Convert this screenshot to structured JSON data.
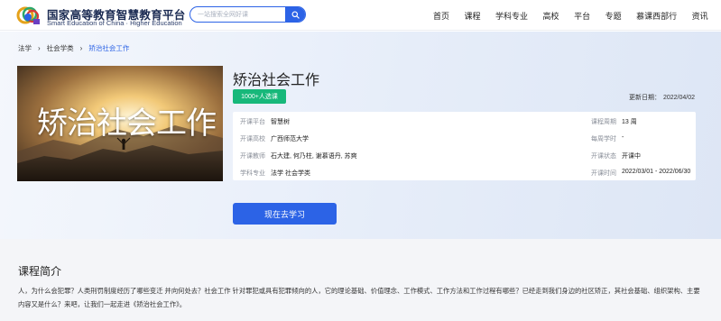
{
  "header": {
    "logo_title": "国家高等教育智慧教育平台",
    "logo_subtitle": "Smart Education of China · Higher Education",
    "search_placeholder": "一站搜索全网好课",
    "nav": [
      "首页",
      "课程",
      "学科专业",
      "高校",
      "平台",
      "专题",
      "慕课西部行",
      "资讯"
    ]
  },
  "breadcrumb": [
    "法学",
    "社会学类",
    "矫治社会工作"
  ],
  "course": {
    "cover_text": "矫治社会工作",
    "title": "矫治社会工作",
    "badge": "1000+人选课",
    "update_label": "更新日期：",
    "update_date": "2022/04/02",
    "info": [
      {
        "k1": "开课平台",
        "v1": "智慧树",
        "k2": "课程周期",
        "v2": "13 周"
      },
      {
        "k1": "开课高校",
        "v1": "广西师范大学",
        "k2": "每周学时",
        "v2": "-"
      },
      {
        "k1": "开课教师",
        "v1": "石大建, 何乃柱, 谢慕语丹, 苏爽",
        "k2": "开课状态",
        "v2": "开课中"
      },
      {
        "k1": "学科专业",
        "v1": "法学  社会学类",
        "k2": "开课时间",
        "v2": "2022/03/01 - 2022/06/30"
      }
    ],
    "study_button": "现在去学习"
  },
  "intro": {
    "title": "课程简介",
    "text": "人，为什么会犯罪？人类刑罚制度经历了哪些变迁 并向何处去？社会工作 针对罪犯或具有犯罪倾向的人，它的理论基础、价值理念、工作模式、工作方法和工作过程有哪些？已经走到我们身边的社区矫正，其社会基础、组织架构、主要内容又是什么？来吧，让我们一起走进《矫治社会工作》。"
  },
  "colors": {
    "accent": "#2c63e6",
    "badge": "#17b87a"
  }
}
